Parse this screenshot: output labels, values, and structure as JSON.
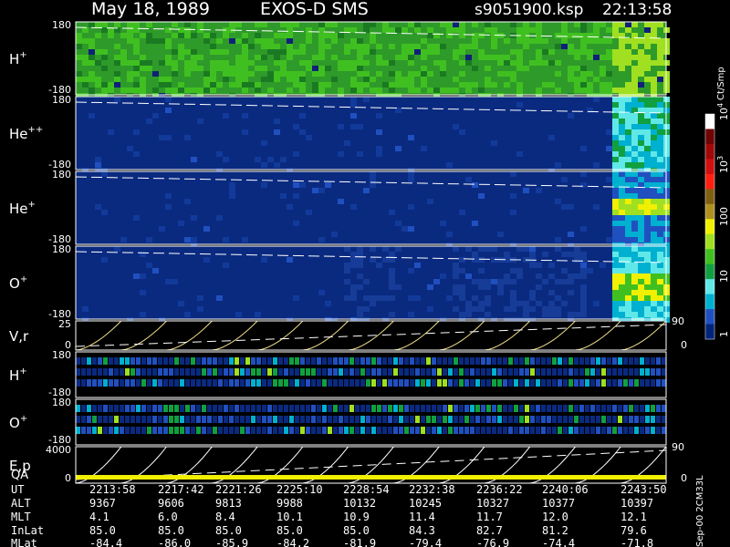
{
  "header": {
    "date": "May 18, 1989",
    "instrument": "EXOS-D SMS",
    "file": "s9051900.ksp",
    "time": "22:13:58"
  },
  "colorbar": {
    "unit": "Ct/Smp",
    "tick_labels": [
      "1",
      "10",
      "100",
      "10",
      "10"
    ],
    "tick_exponents": [
      "",
      "",
      "",
      "3",
      "4"
    ],
    "colors": [
      "#00247a",
      "#2050c0",
      "#00b0d0",
      "#60e8e8",
      "#10a040",
      "#40c020",
      "#a0e020",
      "#f0f000",
      "#b09020",
      "#806010",
      "#ff2010",
      "#d01010",
      "#a00808",
      "#700404",
      "#ffffff"
    ]
  },
  "panels": [
    {
      "species": "H",
      "charge": "+",
      "ymax": "180",
      "ymin": "-180"
    },
    {
      "species": "He",
      "charge": "++",
      "ymax": "180",
      "ymin": "-180"
    },
    {
      "species": "He",
      "charge": "+",
      "ymax": "180",
      "ymin": "-180"
    },
    {
      "species": "O",
      "charge": "+",
      "ymax": "180",
      "ymin": "-180"
    },
    {
      "species": "V,r",
      "charge": "",
      "ymax": "25",
      "ymin": "0",
      "right_max": "90",
      "right_min": "0"
    },
    {
      "species": "H",
      "charge": "+",
      "ymax": "180",
      "ymin": "-180"
    },
    {
      "species": "O",
      "charge": "+",
      "ymax": "180",
      "ymin": "-180"
    },
    {
      "species": "E,p",
      "charge": "",
      "ymax": "4000",
      "ymin": "0",
      "right_max": "90",
      "right_min": "0"
    }
  ],
  "qa_label": "QA",
  "footer_note": "Sep-00 2CM33L",
  "chart_data": {
    "type": "heatmap",
    "title": "May 18, 1989   EXOS-D SMS",
    "x_ticks_ut": [
      "2213:58",
      "2217:42",
      "2221:26",
      "2225:10",
      "2228:54",
      "2232:38",
      "2236:22",
      "2240:06",
      "2243:50"
    ],
    "table": [
      {
        "label": "UT",
        "values": [
          "2213:58",
          "2217:42",
          "2221:26",
          "2225:10",
          "2228:54",
          "2232:38",
          "2236:22",
          "2240:06",
          "2243:50"
        ]
      },
      {
        "label": "ALT",
        "values": [
          "9367",
          "9606",
          "9813",
          "9988",
          "10132",
          "10245",
          "10327",
          "10377",
          "10397"
        ]
      },
      {
        "label": "MLT",
        "values": [
          "4.1",
          "6.0",
          "8.4",
          "10.1",
          "10.9",
          "11.4",
          "11.7",
          "12.0",
          "12.1"
        ]
      },
      {
        "label": "InLat",
        "values": [
          "85.0",
          "85.0",
          "85.0",
          "85.0",
          "85.0",
          "84.3",
          "82.7",
          "81.2",
          "79.6"
        ]
      },
      {
        "label": "MLat",
        "values": [
          "-84.4",
          "-86.0",
          "-85.9",
          "-84.2",
          "-81.9",
          "-79.4",
          "-76.9",
          "-74.4",
          "-71.8"
        ]
      }
    ],
    "colorbar_range_ct_per_sample": [
      1,
      10000
    ],
    "colorbar_scale": "log"
  }
}
